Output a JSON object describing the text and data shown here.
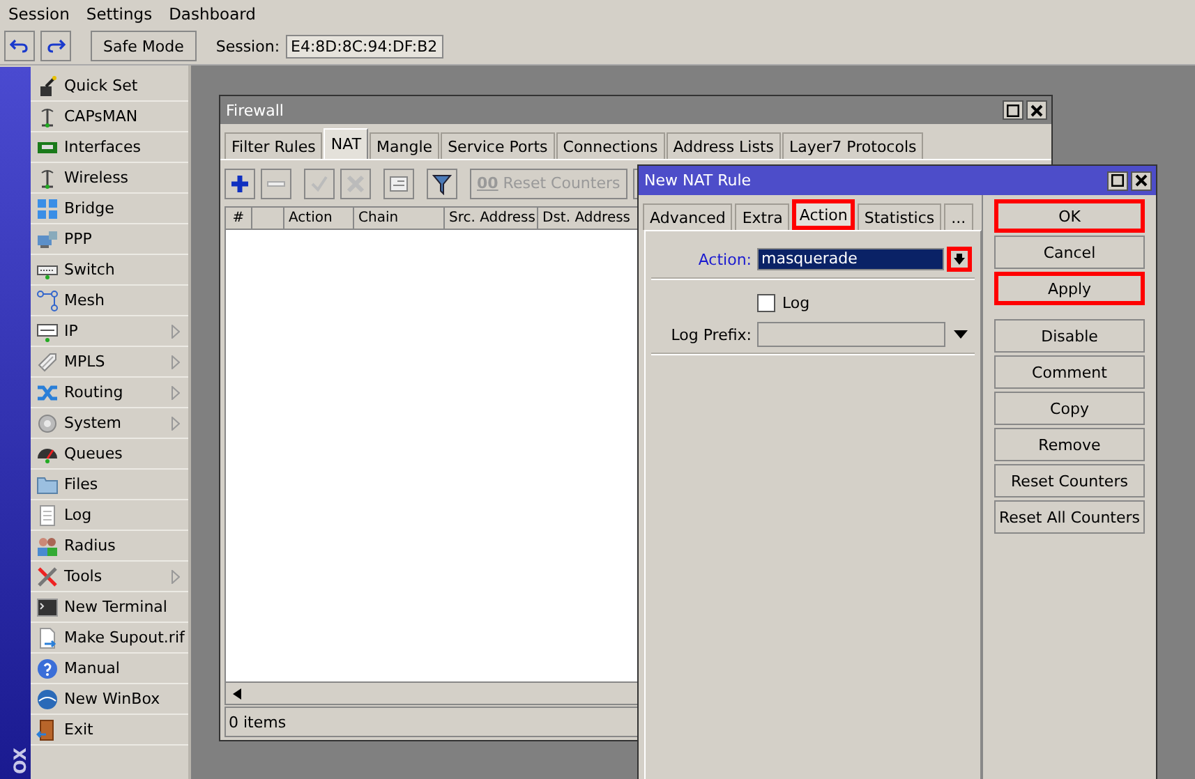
{
  "menu": [
    "Session",
    "Settings",
    "Dashboard"
  ],
  "toolbar": {
    "safe_mode": "Safe Mode",
    "session_label": "Session:",
    "session_value": "E4:8D:8C:94:DF:B2"
  },
  "side_label": "OX",
  "sidebar": [
    {
      "label": "Quick Set",
      "submenu": false
    },
    {
      "label": "CAPsMAN",
      "submenu": false
    },
    {
      "label": "Interfaces",
      "submenu": false
    },
    {
      "label": "Wireless",
      "submenu": false
    },
    {
      "label": "Bridge",
      "submenu": false
    },
    {
      "label": "PPP",
      "submenu": false
    },
    {
      "label": "Switch",
      "submenu": false
    },
    {
      "label": "Mesh",
      "submenu": false
    },
    {
      "label": "IP",
      "submenu": true
    },
    {
      "label": "MPLS",
      "submenu": true
    },
    {
      "label": "Routing",
      "submenu": true
    },
    {
      "label": "System",
      "submenu": true
    },
    {
      "label": "Queues",
      "submenu": false
    },
    {
      "label": "Files",
      "submenu": false
    },
    {
      "label": "Log",
      "submenu": false
    },
    {
      "label": "Radius",
      "submenu": false
    },
    {
      "label": "Tools",
      "submenu": true
    },
    {
      "label": "New Terminal",
      "submenu": false
    },
    {
      "label": "Make Supout.rif",
      "submenu": false
    },
    {
      "label": "Manual",
      "submenu": false
    },
    {
      "label": "New WinBox",
      "submenu": false
    },
    {
      "label": "Exit",
      "submenu": false
    }
  ],
  "firewall": {
    "title": "Firewall",
    "tabs": [
      {
        "label": "Filter Rules",
        "selected": false
      },
      {
        "label": "NAT",
        "selected": true
      },
      {
        "label": "Mangle",
        "selected": false
      },
      {
        "label": "Service Ports",
        "selected": false
      },
      {
        "label": "Connections",
        "selected": false
      },
      {
        "label": "Address Lists",
        "selected": false
      },
      {
        "label": "Layer7 Protocols",
        "selected": false
      }
    ],
    "counter_icon": "00",
    "reset_counters": "Reset Counters",
    "columns": [
      {
        "kind": "text",
        "label": "#"
      },
      {
        "kind": "blank"
      },
      {
        "kind": "text",
        "label": "Action"
      },
      {
        "kind": "text",
        "label": "Chain"
      },
      {
        "kind": "text",
        "label": "Src. Address"
      },
      {
        "kind": "text",
        "label": "Dst. Address"
      }
    ],
    "status": "0 items"
  },
  "dialog": {
    "title": "New NAT Rule",
    "tabs": [
      {
        "label": "Advanced",
        "selected": false,
        "highlighted": false
      },
      {
        "label": "Extra",
        "selected": false,
        "highlighted": false
      },
      {
        "label": "Action",
        "selected": true,
        "highlighted": true
      },
      {
        "label": "Statistics",
        "selected": false,
        "highlighted": false
      },
      {
        "label": "...",
        "selected": false,
        "highlighted": false
      }
    ],
    "action_label": "Action:",
    "action_value": "masquerade",
    "action_dropdown_highlighted": true,
    "log_label": "Log",
    "log_checked": false,
    "log_prefix_label": "Log Prefix:",
    "buttons": [
      {
        "label": "OK",
        "highlighted": true
      },
      {
        "label": "Cancel",
        "highlighted": false
      },
      {
        "label": "Apply",
        "highlighted": true
      }
    ],
    "rule_buttons": [
      {
        "label": "Disable",
        "highlighted": false
      },
      {
        "label": "Comment",
        "highlighted": false
      },
      {
        "label": "Copy",
        "highlighted": false
      },
      {
        "label": "Remove",
        "highlighted": false
      },
      {
        "label": "Reset Counters",
        "highlighted": false
      },
      {
        "label": "Reset All Counters",
        "highlighted": false
      }
    ]
  }
}
